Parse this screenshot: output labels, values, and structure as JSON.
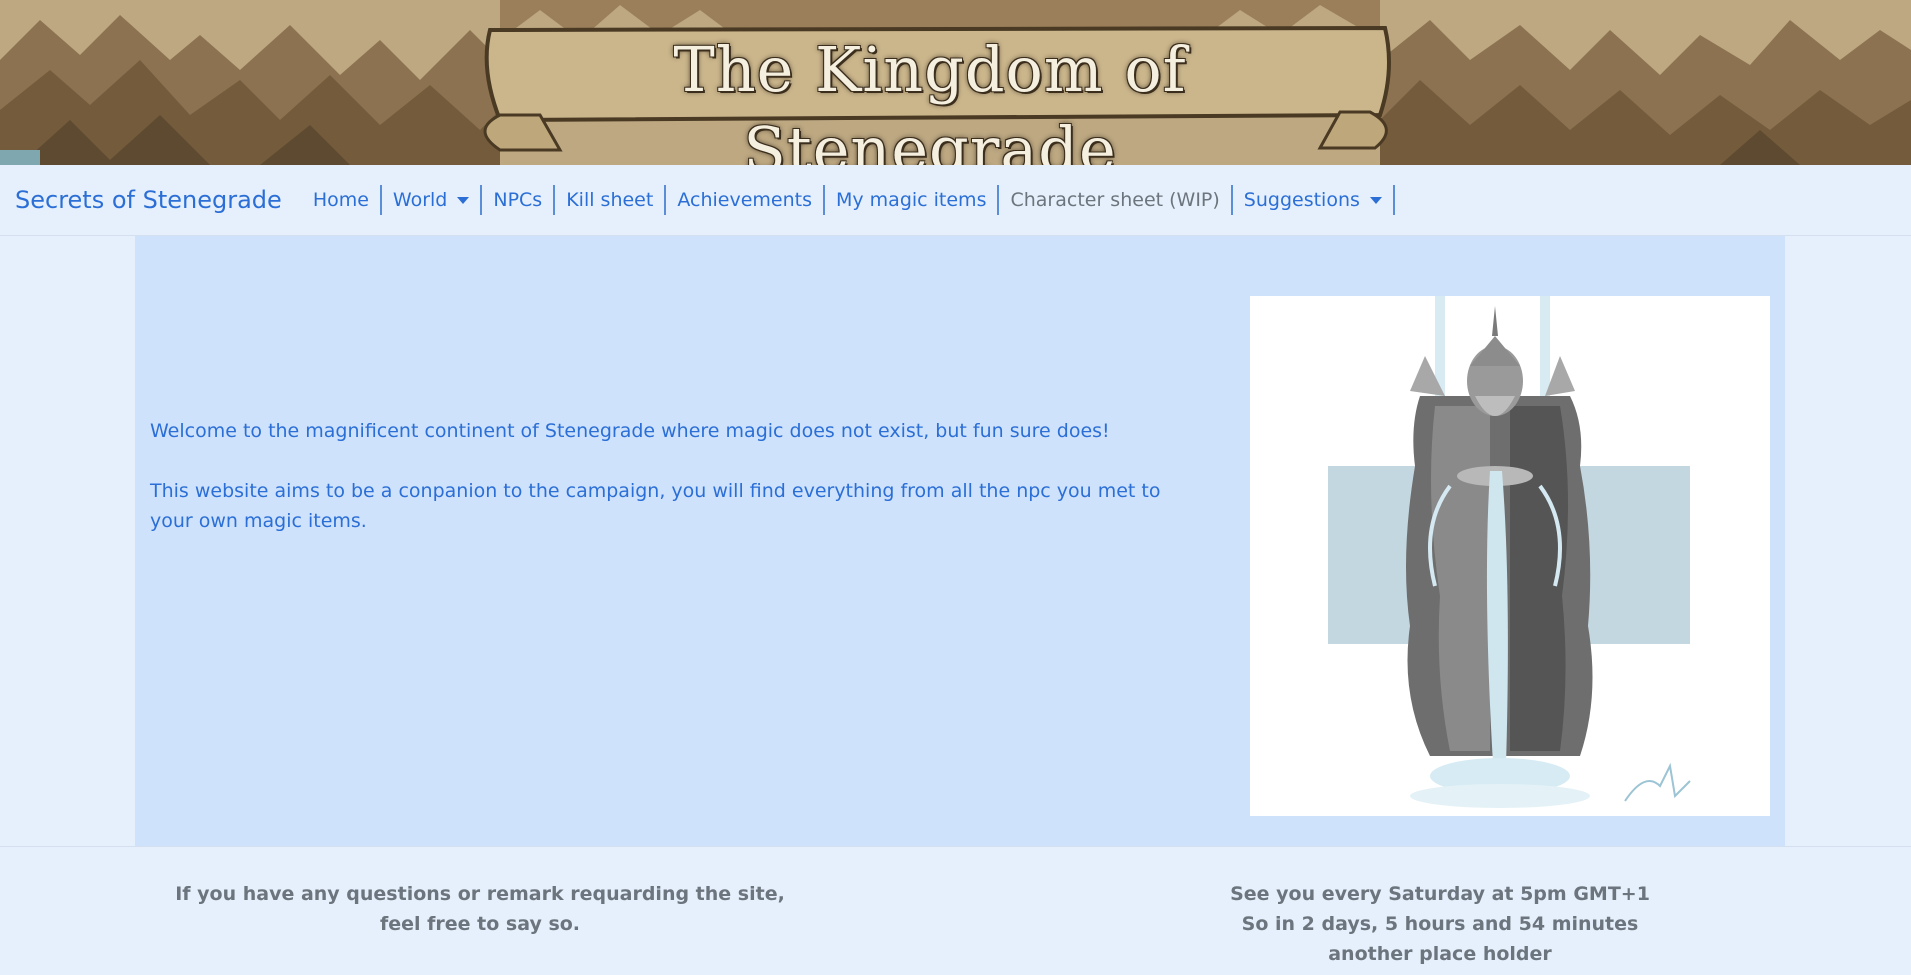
{
  "banner": {
    "title": "The Kingdom of Stenegrade"
  },
  "navbar": {
    "brand": "Secrets of Stenegrade",
    "items": [
      {
        "label": "Home",
        "dropdown": false,
        "muted": false
      },
      {
        "label": "World",
        "dropdown": true,
        "muted": false
      },
      {
        "label": "NPCs",
        "dropdown": false,
        "muted": false
      },
      {
        "label": "Kill sheet",
        "dropdown": false,
        "muted": false
      },
      {
        "label": "Achievements",
        "dropdown": false,
        "muted": false
      },
      {
        "label": "My magic items",
        "dropdown": false,
        "muted": false
      },
      {
        "label": "Character sheet (WIP)",
        "dropdown": false,
        "muted": true
      },
      {
        "label": "Suggestions",
        "dropdown": true,
        "muted": false
      }
    ]
  },
  "main": {
    "welcome": "Welcome to the magnificent continent of Stenegrade where magic does not exist, but fun sure does!",
    "description": "This website aims to be a conpanion to the campaign, you will find everything from all the npc you met to your own magic items."
  },
  "footer": {
    "left_line1": "If you have any questions or remark requarding the site,",
    "left_line2": "feel free to say so.",
    "right_line1": "See you every Saturday at 5pm GMT+1",
    "right_line2": "So in 2 days, 5 hours and 54 minutes",
    "right_line3": "another place holder"
  },
  "colors": {
    "link": "#2b6fd6",
    "muted": "#6c757d",
    "page_bg": "#e6f0fc",
    "main_bg": "#cfe2fc"
  }
}
